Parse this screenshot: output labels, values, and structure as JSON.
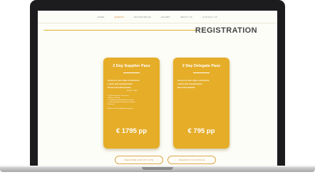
{
  "nav": {
    "items": [
      "HOME",
      "EVENTS",
      "SPONSORSHIP",
      "EXHIBIT",
      "ABOUT US",
      "CONTACT US"
    ]
  },
  "page": {
    "title": "REGISTRATION"
  },
  "cards": [
    {
      "title": "2 Day Supplier Pass",
      "features": [
        "Access to two days conference",
        "Lunch and refreshments",
        "Promo Item Placement"
      ],
      "fine_heading": "(SELECT ONE)",
      "fine_lines": [
        "1 x Bob Up Banner Placement",
        "(250mm x 82mm)",
        "1 x Delegate Handout (A4 Size Page)",
        "1 x A3 Page Advert Placement (in Event",
        "Brochure)",
        "Materials to be supplied by organiser"
      ],
      "price": "€ 1795 pp"
    },
    {
      "title": "2 Day Delegate Pass",
      "features": [
        "Access to two days conference",
        "Lunch and refreshments",
        "Non-Transferable"
      ],
      "price": "€ 795 pp"
    }
  ],
  "buttons": {
    "register": "REGISTER AND PAY NOW",
    "enquiry": "REQUEST AN INVOICE"
  },
  "colors": {
    "accent": "#e5ad28",
    "nav_active": "#d27a1e",
    "title": "#444444"
  }
}
